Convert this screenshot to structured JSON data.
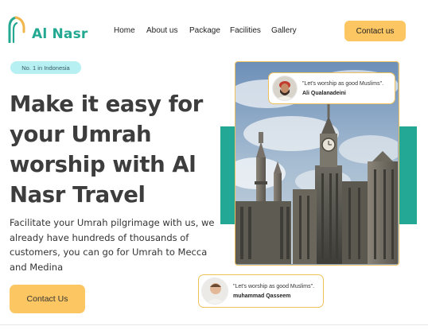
{
  "brand": {
    "name": "Al Nasr",
    "color": "#23a892",
    "icon": "arch-logo-icon"
  },
  "nav": {
    "items": [
      {
        "label": "Home"
      },
      {
        "label": "About us"
      },
      {
        "label": "Package"
      },
      {
        "label": "Facilities"
      },
      {
        "label": "Gallery"
      }
    ],
    "contact_label": "Contact us"
  },
  "hero": {
    "badge": "No. 1 in Indonesia",
    "title": "Make it easy for your Umrah worship with Al Nasr Travel",
    "description": "Facilitate your Umrah pilgrimage with us, we already have hundreds of thousands of customers, you can go for Umrah to Mecca and Medina",
    "cta_label": "Contact Us",
    "image": "mecca-clock-tower-image"
  },
  "testimonials": [
    {
      "quote": "\"Let's worship as good Muslims\".",
      "name": "Ali Qualanadeini",
      "avatar": "man-avatar"
    },
    {
      "quote": "\"Let's worship as good Muslims\".",
      "name": "muhammad Qasseem",
      "avatar": "child-avatar"
    }
  ],
  "colors": {
    "accent": "#fcc663",
    "teal": "#22a894",
    "badge_bg": "#b6f0f3"
  }
}
